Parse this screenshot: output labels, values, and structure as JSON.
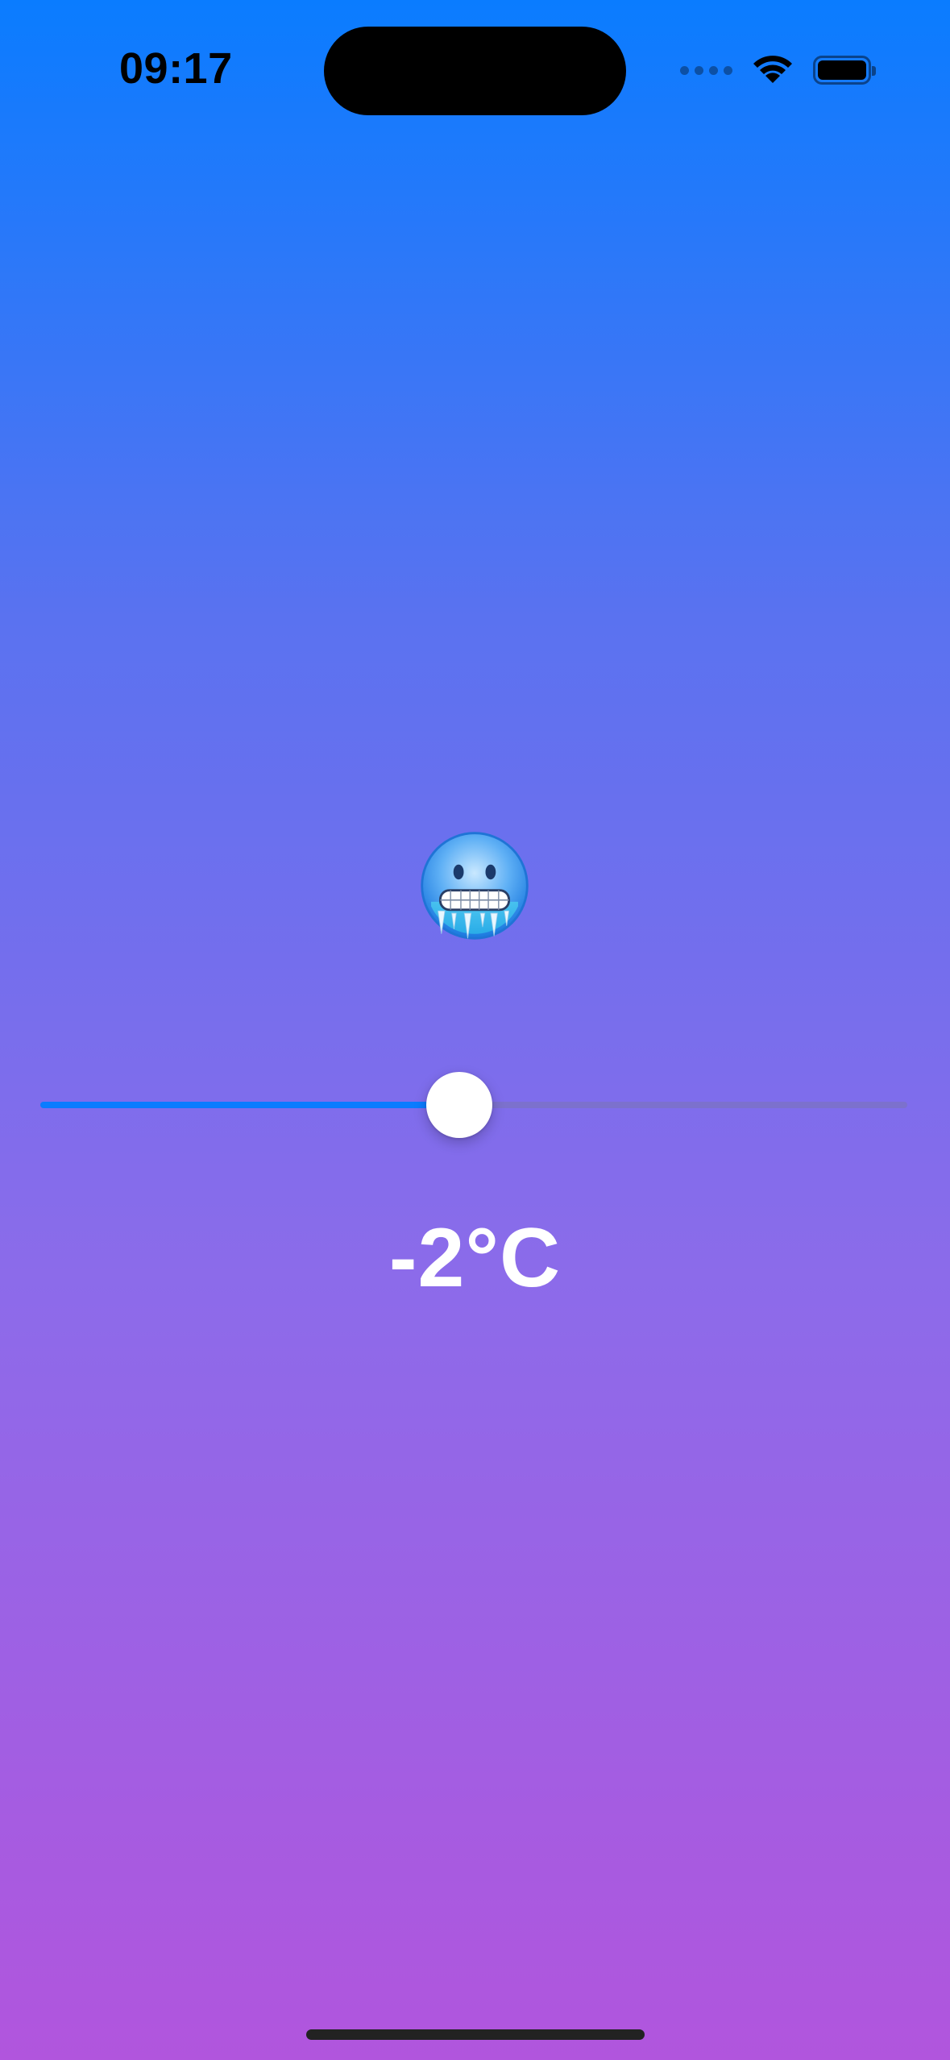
{
  "status_bar": {
    "time": "09:17",
    "icons": [
      "cellular-dots-icon",
      "wifi-icon",
      "battery-icon"
    ]
  },
  "main": {
    "emoji": "cold-face-emoji",
    "temperature_label": "-2°C",
    "slider": {
      "value_fraction": 0.483,
      "fill_color": "#0A7CFF"
    }
  },
  "colors": {
    "gradient_top": "#0A7CFF",
    "gradient_bottom": "#B155DD",
    "text": "#FFFFFF"
  }
}
